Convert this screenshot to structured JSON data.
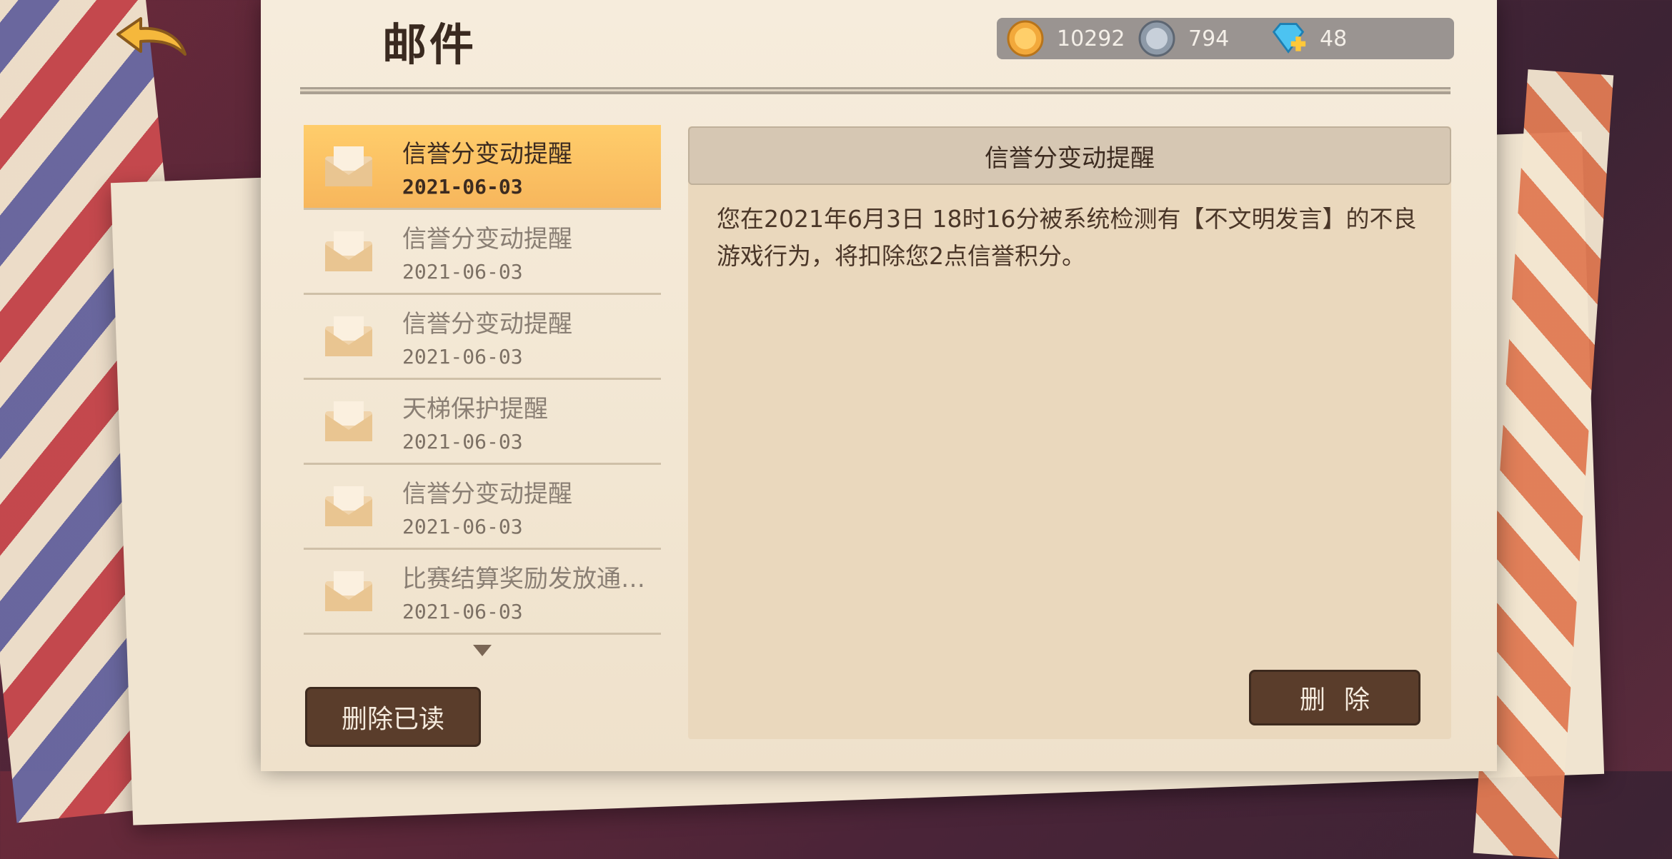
{
  "page": {
    "title": "邮件"
  },
  "currencies": [
    {
      "name": "gold-coin",
      "value": "10292",
      "color": "#f2a93b"
    },
    {
      "name": "silver-coin",
      "value": "794",
      "color": "#a9b4c0"
    },
    {
      "name": "diamond",
      "value": "48",
      "color": "#4cc3f1"
    }
  ],
  "mails": [
    {
      "subject": "信誉分变动提醒",
      "date": "2021-06-03",
      "selected": true
    },
    {
      "subject": "信誉分变动提醒",
      "date": "2021-06-03"
    },
    {
      "subject": "信誉分变动提醒",
      "date": "2021-06-03"
    },
    {
      "subject": "天梯保护提醒",
      "date": "2021-06-03"
    },
    {
      "subject": "信誉分变动提醒",
      "date": "2021-06-03"
    },
    {
      "subject": "比赛结算奖励发放通…",
      "date": "2021-06-03"
    }
  ],
  "detail": {
    "title": "信誉分变动提醒",
    "body": "您在2021年6月3日 18时16分被系统检测有【不文明发言】的不良游戏行为，将扣除您2点信誉积分。"
  },
  "buttons": {
    "delete_read": "删除已读",
    "delete": "删除"
  },
  "colors": {
    "selected": "#ffc865",
    "button": "#5a3d2b"
  }
}
